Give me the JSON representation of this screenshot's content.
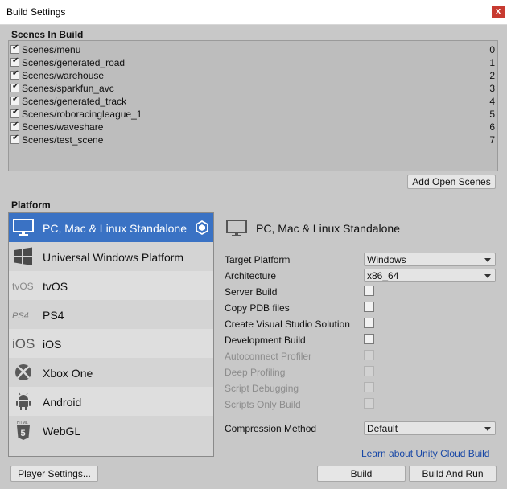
{
  "window": {
    "title": "Build Settings",
    "close_glyph": "x"
  },
  "scenes": {
    "header": "Scenes In Build",
    "items": [
      {
        "name": "Scenes/menu",
        "index": "0",
        "checked": true
      },
      {
        "name": "Scenes/generated_road",
        "index": "1",
        "checked": true
      },
      {
        "name": "Scenes/warehouse",
        "index": "2",
        "checked": true
      },
      {
        "name": "Scenes/sparkfun_avc",
        "index": "3",
        "checked": true
      },
      {
        "name": "Scenes/generated_track",
        "index": "4",
        "checked": true
      },
      {
        "name": "Scenes/roboracingleague_1",
        "index": "5",
        "checked": true
      },
      {
        "name": "Scenes/waveshare",
        "index": "6",
        "checked": true
      },
      {
        "name": "Scenes/test_scene",
        "index": "7",
        "checked": true
      }
    ],
    "add_open_scenes_label": "Add Open Scenes"
  },
  "platform": {
    "header": "Platform",
    "items": [
      {
        "label": "PC, Mac & Linux Standalone",
        "icon": "monitor-icon",
        "selected": true
      },
      {
        "label": "Universal Windows Platform",
        "icon": "windows-icon",
        "selected": false
      },
      {
        "label": "tvOS",
        "icon": "tvos-icon",
        "icon_text": "tvOS",
        "selected": false
      },
      {
        "label": "PS4",
        "icon": "ps4-icon",
        "icon_text": "PS4",
        "selected": false
      },
      {
        "label": "iOS",
        "icon": "ios-icon",
        "icon_text": "iOS",
        "selected": false
      },
      {
        "label": "Xbox One",
        "icon": "xbox-icon",
        "selected": false
      },
      {
        "label": "Android",
        "icon": "android-icon",
        "selected": false
      },
      {
        "label": "WebGL",
        "icon": "html5-icon",
        "icon_text": "5",
        "icon_caption": "HTML",
        "selected": false
      }
    ]
  },
  "details": {
    "title": "PC, Mac & Linux Standalone",
    "target_platform": {
      "label": "Target Platform",
      "value": "Windows"
    },
    "architecture": {
      "label": "Architecture",
      "value": "x86_64"
    },
    "options": [
      {
        "label": "Server Build",
        "checked": false,
        "enabled": true
      },
      {
        "label": "Copy PDB files",
        "checked": false,
        "enabled": true
      },
      {
        "label": "Create Visual Studio Solution",
        "checked": false,
        "enabled": true
      },
      {
        "label": "Development Build",
        "checked": false,
        "enabled": true
      },
      {
        "label": "Autoconnect Profiler",
        "checked": false,
        "enabled": false
      },
      {
        "label": "Deep Profiling",
        "checked": false,
        "enabled": false
      },
      {
        "label": "Script Debugging",
        "checked": false,
        "enabled": false
      },
      {
        "label": "Scripts Only Build",
        "checked": false,
        "enabled": false
      }
    ],
    "compression": {
      "label": "Compression Method",
      "value": "Default"
    }
  },
  "footer": {
    "cloud_link": "Learn about Unity Cloud Build",
    "player_settings_label": "Player Settings...",
    "build_label": "Build",
    "build_and_run_label": "Build And Run"
  },
  "colors": {
    "selection": "#3a72c4",
    "close_button": "#c73a30",
    "link": "#1747a6"
  }
}
